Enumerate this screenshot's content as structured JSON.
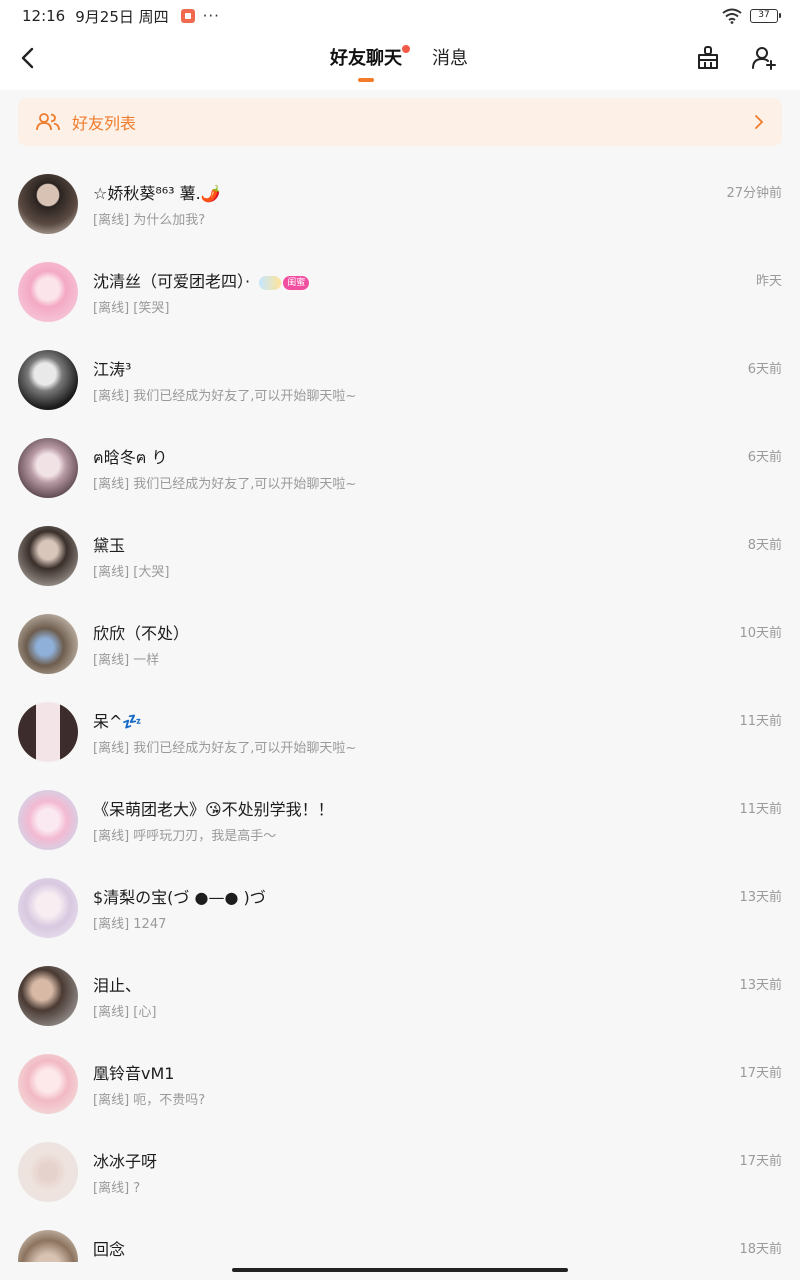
{
  "status": {
    "time": "12:16",
    "date": "9月25日 周四",
    "more": "···",
    "battery": "37"
  },
  "nav": {
    "tabs": [
      {
        "label": "好友聊天",
        "active": true
      },
      {
        "label": "消息",
        "active": false
      }
    ]
  },
  "friend_list_bar": {
    "label": "好友列表"
  },
  "badge": {
    "label": "闺蜜"
  },
  "colors": {
    "accent": "#f47b29",
    "red_dot": "#f25a4a"
  },
  "contacts": [
    {
      "name": "☆娇秋葵⁸⁶³ 薯.🌶️",
      "preview": "[离线] 为什么加我?",
      "time": "27分钟前"
    },
    {
      "name": "沈清丝（可爱团老四）·",
      "preview": "[离线] [笑哭]",
      "time": "昨天"
    },
    {
      "name": "江涛³",
      "preview": "[离线] 我们已经成为好友了,可以开始聊天啦~",
      "time": "6天前"
    },
    {
      "name": "ฅ晗冬ฅ り",
      "preview": "[离线] 我们已经成为好友了,可以开始聊天啦~",
      "time": "6天前"
    },
    {
      "name": "黛玉",
      "preview": "[离线] [大哭]",
      "time": "8天前"
    },
    {
      "name": "欣欣（不处）",
      "preview": "[离线] 一样",
      "time": "10天前"
    },
    {
      "name": "呆^💤",
      "preview": "[离线] 我们已经成为好友了,可以开始聊天啦~",
      "time": "11天前"
    },
    {
      "name": "《呆萌团老大》😘不处别学我！！",
      "preview": "[离线] 呼呼玩刀刃，我是高手～",
      "time": "11天前"
    },
    {
      "name": "$清梨の宝(づ ●—● )づ",
      "preview": "[离线] 1247",
      "time": "13天前"
    },
    {
      "name": "泪止、",
      "preview": "[离线] [心]",
      "time": "13天前"
    },
    {
      "name": "凰铃音vM1",
      "preview": "[离线] 呃，不贵吗?",
      "time": "17天前"
    },
    {
      "name": "冰冰子呀",
      "preview": "[离线] ?",
      "time": "17天前"
    },
    {
      "name": "回念",
      "preview": "",
      "time": "18天前"
    }
  ]
}
